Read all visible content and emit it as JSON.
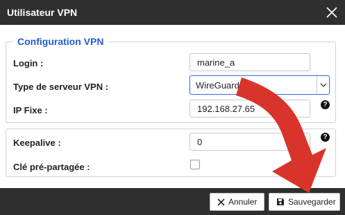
{
  "window": {
    "title": "Utilisateur VPN",
    "close_icon": "close-icon"
  },
  "section1": {
    "legend": "Configuration VPN",
    "login_label": "Login :",
    "login_value": "marine_a",
    "server_type_label": "Type de serveur VPN :",
    "server_type_value": "WireGuard",
    "ip_label": "IP Fixe :",
    "ip_value": "192.168.27.65",
    "ip_help": "?"
  },
  "section2": {
    "keepalive_label": "Keepalive :",
    "keepalive_value": "0",
    "keepalive_help": "?",
    "psk_label": "Clé pré-partagée :",
    "psk_checked": false
  },
  "footer": {
    "cancel_label": "Annuler",
    "save_label": "Sauvegarder"
  },
  "colors": {
    "accent": "#1f5ed0",
    "annotation_arrow": "#d9342b",
    "titlebar": "#2f2f2f"
  }
}
